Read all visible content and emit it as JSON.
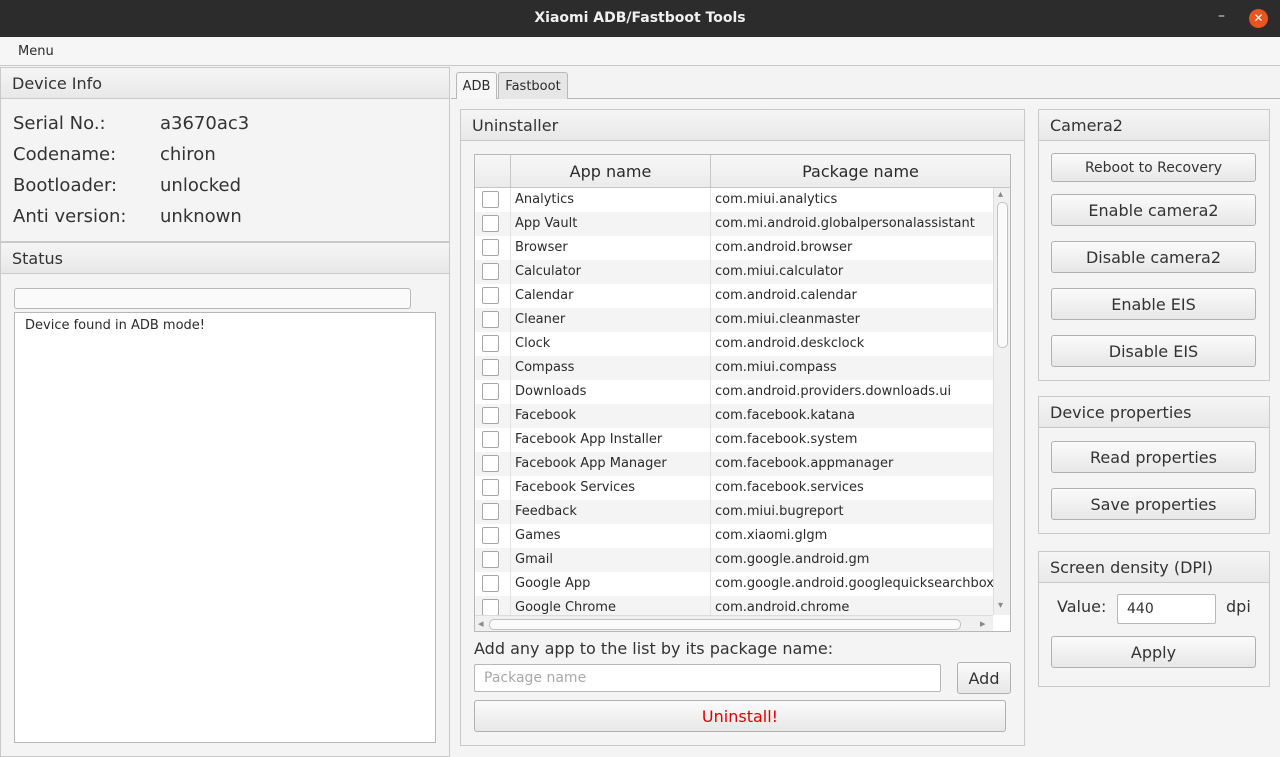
{
  "window": {
    "title": "Xiaomi ADB/Fastboot Tools"
  },
  "menubar": {
    "menu": "Menu"
  },
  "device_info": {
    "header": "Device Info",
    "rows": [
      {
        "key": "Serial No.:",
        "value": "a3670ac3"
      },
      {
        "key": "Codename:",
        "value": "chiron"
      },
      {
        "key": "Bootloader:",
        "value": "unlocked"
      },
      {
        "key": "Anti version:",
        "value": "unknown"
      }
    ]
  },
  "status": {
    "header": "Status",
    "progress": 0,
    "log": "Device found in ADB mode!"
  },
  "tabs": [
    {
      "label": "ADB",
      "active": true
    },
    {
      "label": "Fastboot",
      "active": false
    }
  ],
  "uninstaller": {
    "header": "Uninstaller",
    "columns": [
      "App name",
      "Package name"
    ],
    "rows": [
      {
        "name": "Analytics",
        "package": "com.miui.analytics"
      },
      {
        "name": "App Vault",
        "package": "com.mi.android.globalpersonalassistant"
      },
      {
        "name": "Browser",
        "package": "com.android.browser"
      },
      {
        "name": "Calculator",
        "package": "com.miui.calculator"
      },
      {
        "name": "Calendar",
        "package": "com.android.calendar"
      },
      {
        "name": "Cleaner",
        "package": "com.miui.cleanmaster"
      },
      {
        "name": "Clock",
        "package": "com.android.deskclock"
      },
      {
        "name": "Compass",
        "package": "com.miui.compass"
      },
      {
        "name": "Downloads",
        "package": "com.android.providers.downloads.ui"
      },
      {
        "name": "Facebook",
        "package": "com.facebook.katana"
      },
      {
        "name": "Facebook App Installer",
        "package": "com.facebook.system"
      },
      {
        "name": "Facebook App Manager",
        "package": "com.facebook.appmanager"
      },
      {
        "name": "Facebook Services",
        "package": "com.facebook.services"
      },
      {
        "name": "Feedback",
        "package": "com.miui.bugreport"
      },
      {
        "name": "Games",
        "package": "com.xiaomi.glgm"
      },
      {
        "name": "Gmail",
        "package": "com.google.android.gm"
      },
      {
        "name": "Google App",
        "package": "com.google.android.googlequicksearchbox"
      },
      {
        "name": "Google Chrome",
        "package": "com.android.chrome"
      }
    ],
    "add_label": "Add any app to the list by its package name:",
    "package_placeholder": "Package name",
    "add_button": "Add",
    "uninstall_button": "Uninstall!",
    "uninstall_color": "#e00000"
  },
  "camera2": {
    "header": "Camera2",
    "reboot_recovery": "Reboot to Recovery",
    "enable_camera2": "Enable camera2",
    "disable_camera2": "Disable camera2",
    "enable_eis": "Enable EIS",
    "disable_eis": "Disable EIS"
  },
  "device_properties": {
    "header": "Device properties",
    "read": "Read properties",
    "save": "Save properties"
  },
  "screen_density": {
    "header": "Screen density (DPI)",
    "value_label": "Value:",
    "value": "440",
    "unit": "dpi",
    "apply": "Apply"
  }
}
